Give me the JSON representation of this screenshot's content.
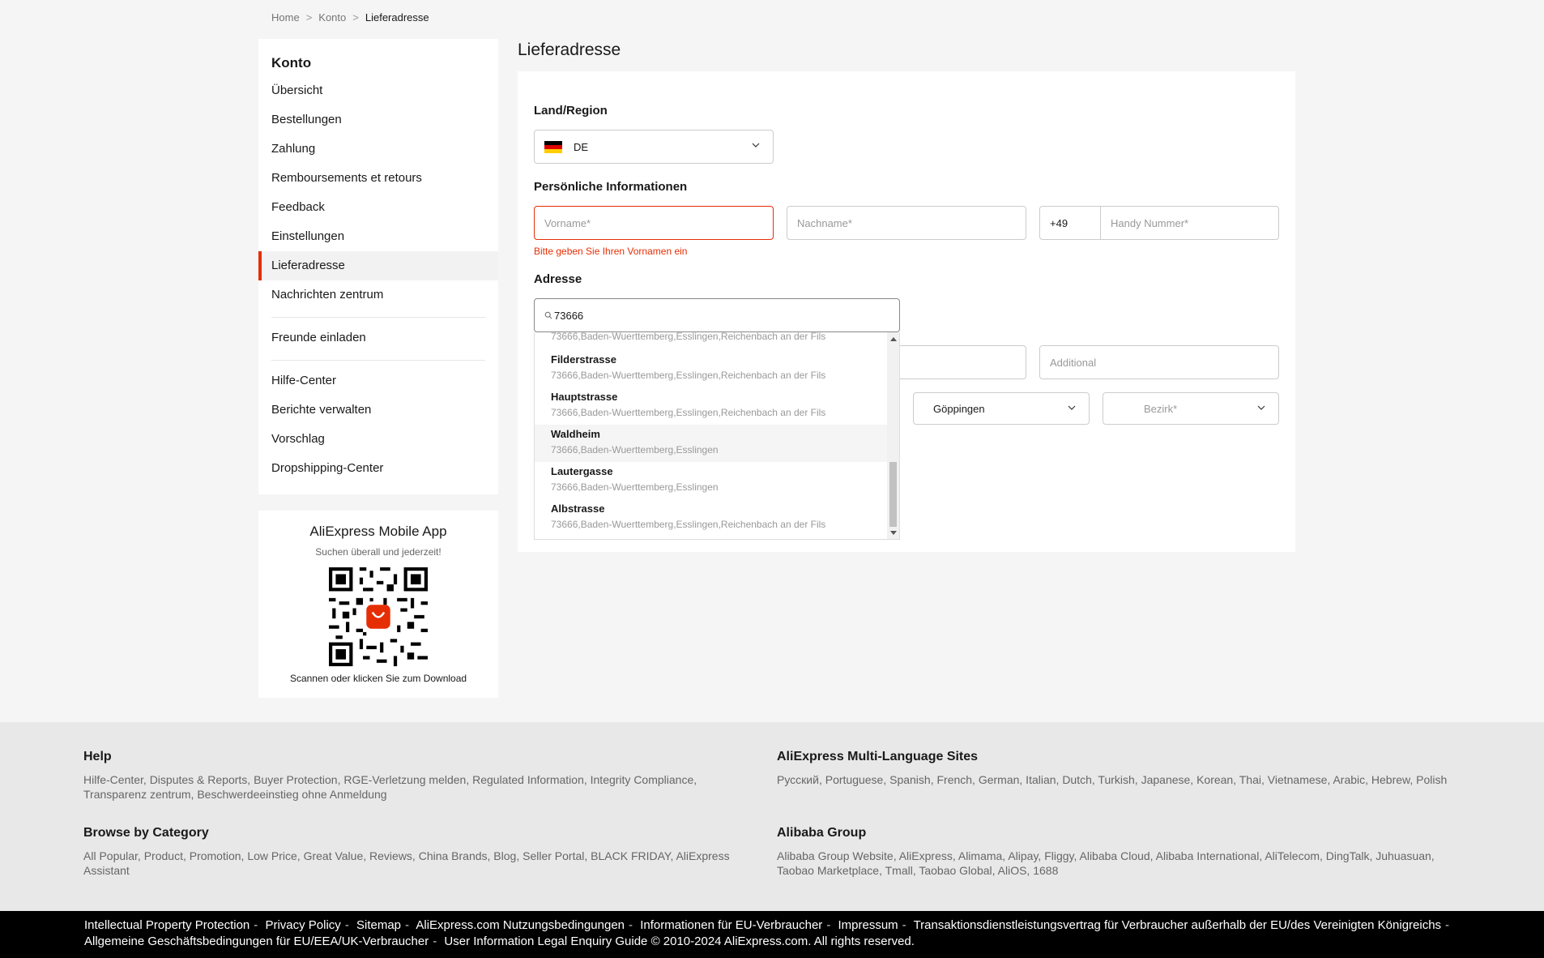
{
  "breadcrumb": {
    "home": "Home",
    "account": "Konto",
    "current": "Lieferadresse"
  },
  "sidebar": {
    "title": "Konto",
    "items": [
      {
        "label": "Übersicht"
      },
      {
        "label": "Bestellungen"
      },
      {
        "label": "Zahlung"
      },
      {
        "label": "Remboursements et retours"
      },
      {
        "label": "Feedback"
      },
      {
        "label": "Einstellungen"
      },
      {
        "label": "Lieferadresse",
        "active": true
      },
      {
        "label": "Nachrichten zentrum"
      },
      {
        "label": "Freunde einladen"
      },
      {
        "label": "Hilfe-Center"
      },
      {
        "label": "Berichte verwalten"
      },
      {
        "label": "Vorschlag"
      },
      {
        "label": "Dropshipping-Center"
      }
    ]
  },
  "app_box": {
    "title": "AliExpress Mobile App",
    "subtitle": "Suchen überall und jederzeit!",
    "download": "Scannen oder klicken Sie zum Download"
  },
  "form": {
    "title": "Lieferadresse",
    "country_label": "Land/Region",
    "country_value": "DE",
    "personal_label": "Persönliche Informationen",
    "firstname_placeholder": "Vorname*",
    "lastname_placeholder": "Nachname*",
    "phone_code": "+49",
    "phone_placeholder": "Handy Nummer*",
    "firstname_error": "Bitte geben Sie Ihren Vornamen ein",
    "address_label": "Adresse",
    "search_value": "73666",
    "additional_placeholder": "Additional",
    "city_value": "Göppingen",
    "district_placeholder": "Bezirk*"
  },
  "suggestions": {
    "partial_detail": "73666,Baden-Wuerttemberg,Esslingen,Reichenbach an der Fils",
    "items": [
      {
        "name": "Filderstrasse",
        "detail": "73666,Baden-Wuerttemberg,Esslingen,Reichenbach an der Fils"
      },
      {
        "name": "Hauptstrasse",
        "detail": "73666,Baden-Wuerttemberg,Esslingen,Reichenbach an der Fils"
      },
      {
        "name": "Waldheim",
        "detail": "73666,Baden-Wuerttemberg,Esslingen"
      },
      {
        "name": "Lautergasse",
        "detail": "73666,Baden-Wuerttemberg,Esslingen"
      },
      {
        "name": "Albstrasse",
        "detail": "73666,Baden-Wuerttemberg,Esslingen,Reichenbach an der Fils"
      }
    ]
  },
  "footer": {
    "help_title": "Help",
    "help_text": "Hilfe-Center, Disputes & Reports, Buyer Protection, RGE-Verletzung melden, Regulated Information, Integrity Compliance, Transparenz zentrum, Beschwerdeeinstieg ohne Anmeldung",
    "multilang_title": "AliExpress Multi-Language Sites",
    "multilang_text": "Русский, Portuguese, Spanish, French, German, Italian, Dutch, Turkish, Japanese, Korean, Thai, Vietnamese, Arabic, Hebrew, Polish",
    "category_title": "Browse by Category",
    "category_text": "All Popular, Product, Promotion, Low Price, Great Value, Reviews, China Brands, Blog, Seller Portal, BLACK FRIDAY, AliExpress Assistant",
    "alibaba_title": "Alibaba Group",
    "alibaba_text": "Alibaba Group Website, AliExpress, Alimama, Alipay, Fliggy, Alibaba Cloud, Alibaba International, AliTelecom, DingTalk, Juhuasuan, Taobao Marketplace, Tmall, Taobao Global, AliOS, 1688"
  },
  "bottom_links": {
    "row1": [
      "Intellectual Property Protection",
      "Privacy Policy",
      "Sitemap",
      "AliExpress.com Nutzungsbedingungen",
      "Informationen für EU-Verbraucher",
      "Impressum",
      "Transaktionsdienstleistungsvertrag für Verbraucher außerhalb der EU/des Vereinigten Königreichs"
    ],
    "row2": [
      "Allgemeine Geschäftsbedingungen für EU/EEA/UK-Verbraucher",
      "User Information Legal Enquiry Guide"
    ],
    "copyright": "© 2010-2024 AliExpress.com. All rights reserved."
  },
  "colors": {
    "accent": "#e62e04",
    "footer_bg": "#e8e8e8",
    "bottom_bar": "#000000"
  }
}
